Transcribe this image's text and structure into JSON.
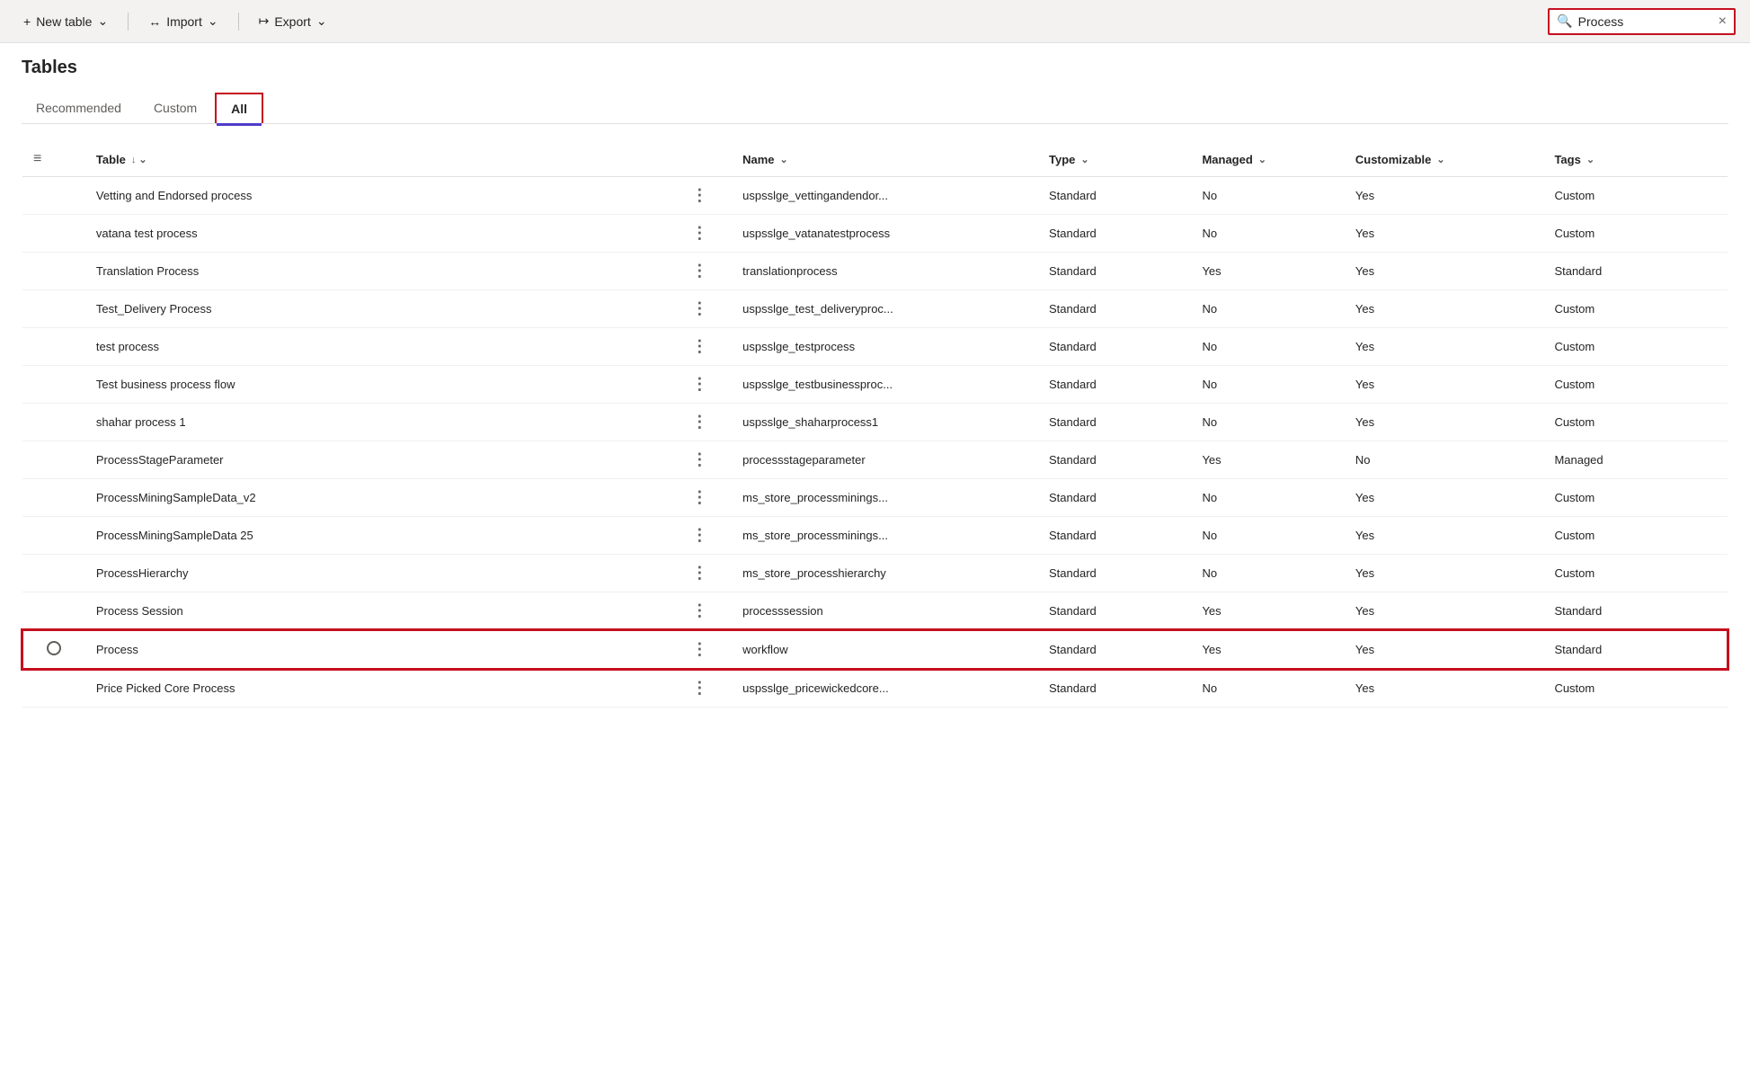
{
  "toolbar": {
    "new_table_label": "New table",
    "import_label": "Import",
    "export_label": "Export",
    "search_value": "Process",
    "search_placeholder": "Search"
  },
  "page": {
    "title": "Tables"
  },
  "tabs": [
    {
      "id": "recommended",
      "label": "Recommended",
      "active": false
    },
    {
      "id": "custom",
      "label": "Custom",
      "active": false
    },
    {
      "id": "all",
      "label": "All",
      "active": true
    }
  ],
  "table": {
    "columns": [
      {
        "id": "table",
        "label": "Table",
        "sort": true
      },
      {
        "id": "name",
        "label": "Name",
        "sort": true
      },
      {
        "id": "type",
        "label": "Type",
        "sort": true
      },
      {
        "id": "managed",
        "label": "Managed",
        "sort": true
      },
      {
        "id": "customizable",
        "label": "Customizable",
        "sort": true
      },
      {
        "id": "tags",
        "label": "Tags",
        "sort": true
      }
    ],
    "rows": [
      {
        "id": 1,
        "table": "Vetting and Endorsed process",
        "name": "uspsslge_vettingandendor...",
        "type": "Standard",
        "managed": "No",
        "customizable": "Yes",
        "tags": "Custom",
        "selected": false
      },
      {
        "id": 2,
        "table": "vatana test process",
        "name": "uspsslge_vatanatestprocess",
        "type": "Standard",
        "managed": "No",
        "customizable": "Yes",
        "tags": "Custom",
        "selected": false
      },
      {
        "id": 3,
        "table": "Translation Process",
        "name": "translationprocess",
        "type": "Standard",
        "managed": "Yes",
        "customizable": "Yes",
        "tags": "Standard",
        "selected": false
      },
      {
        "id": 4,
        "table": "Test_Delivery Process",
        "name": "uspsslge_test_deliveryproc...",
        "type": "Standard",
        "managed": "No",
        "customizable": "Yes",
        "tags": "Custom",
        "selected": false
      },
      {
        "id": 5,
        "table": "test process",
        "name": "uspsslge_testprocess",
        "type": "Standard",
        "managed": "No",
        "customizable": "Yes",
        "tags": "Custom",
        "selected": false
      },
      {
        "id": 6,
        "table": "Test business process flow",
        "name": "uspsslge_testbusinessproc...",
        "type": "Standard",
        "managed": "No",
        "customizable": "Yes",
        "tags": "Custom",
        "selected": false
      },
      {
        "id": 7,
        "table": "shahar process 1",
        "name": "uspsslge_shaharprocess1",
        "type": "Standard",
        "managed": "No",
        "customizable": "Yes",
        "tags": "Custom",
        "selected": false
      },
      {
        "id": 8,
        "table": "ProcessStageParameter",
        "name": "processstageparameter",
        "type": "Standard",
        "managed": "Yes",
        "customizable": "No",
        "tags": "Managed",
        "selected": false
      },
      {
        "id": 9,
        "table": "ProcessMiningSampleData_v2",
        "name": "ms_store_processminings...",
        "type": "Standard",
        "managed": "No",
        "customizable": "Yes",
        "tags": "Custom",
        "selected": false
      },
      {
        "id": 10,
        "table": "ProcessMiningSampleData 25",
        "name": "ms_store_processminings...",
        "type": "Standard",
        "managed": "No",
        "customizable": "Yes",
        "tags": "Custom",
        "selected": false
      },
      {
        "id": 11,
        "table": "ProcessHierarchy",
        "name": "ms_store_processhierarchy",
        "type": "Standard",
        "managed": "No",
        "customizable": "Yes",
        "tags": "Custom",
        "selected": false
      },
      {
        "id": 12,
        "table": "Process Session",
        "name": "processsession",
        "type": "Standard",
        "managed": "Yes",
        "customizable": "Yes",
        "tags": "Standard",
        "selected": false
      },
      {
        "id": 13,
        "table": "Process",
        "name": "workflow",
        "type": "Standard",
        "managed": "Yes",
        "customizable": "Yes",
        "tags": "Standard",
        "selected": true
      },
      {
        "id": 14,
        "table": "Price Picked Core Process",
        "name": "uspsslge_pricewickedcore...",
        "type": "Standard",
        "managed": "No",
        "customizable": "Yes",
        "tags": "Custom",
        "selected": false
      }
    ]
  },
  "icons": {
    "search": "🔍",
    "plus": "+",
    "import_arrow": "↔",
    "export_arrow": "↦",
    "chevron_down": "∨",
    "sort_down": "↓",
    "menu_dots": "⋮",
    "list_icon": "≡"
  }
}
